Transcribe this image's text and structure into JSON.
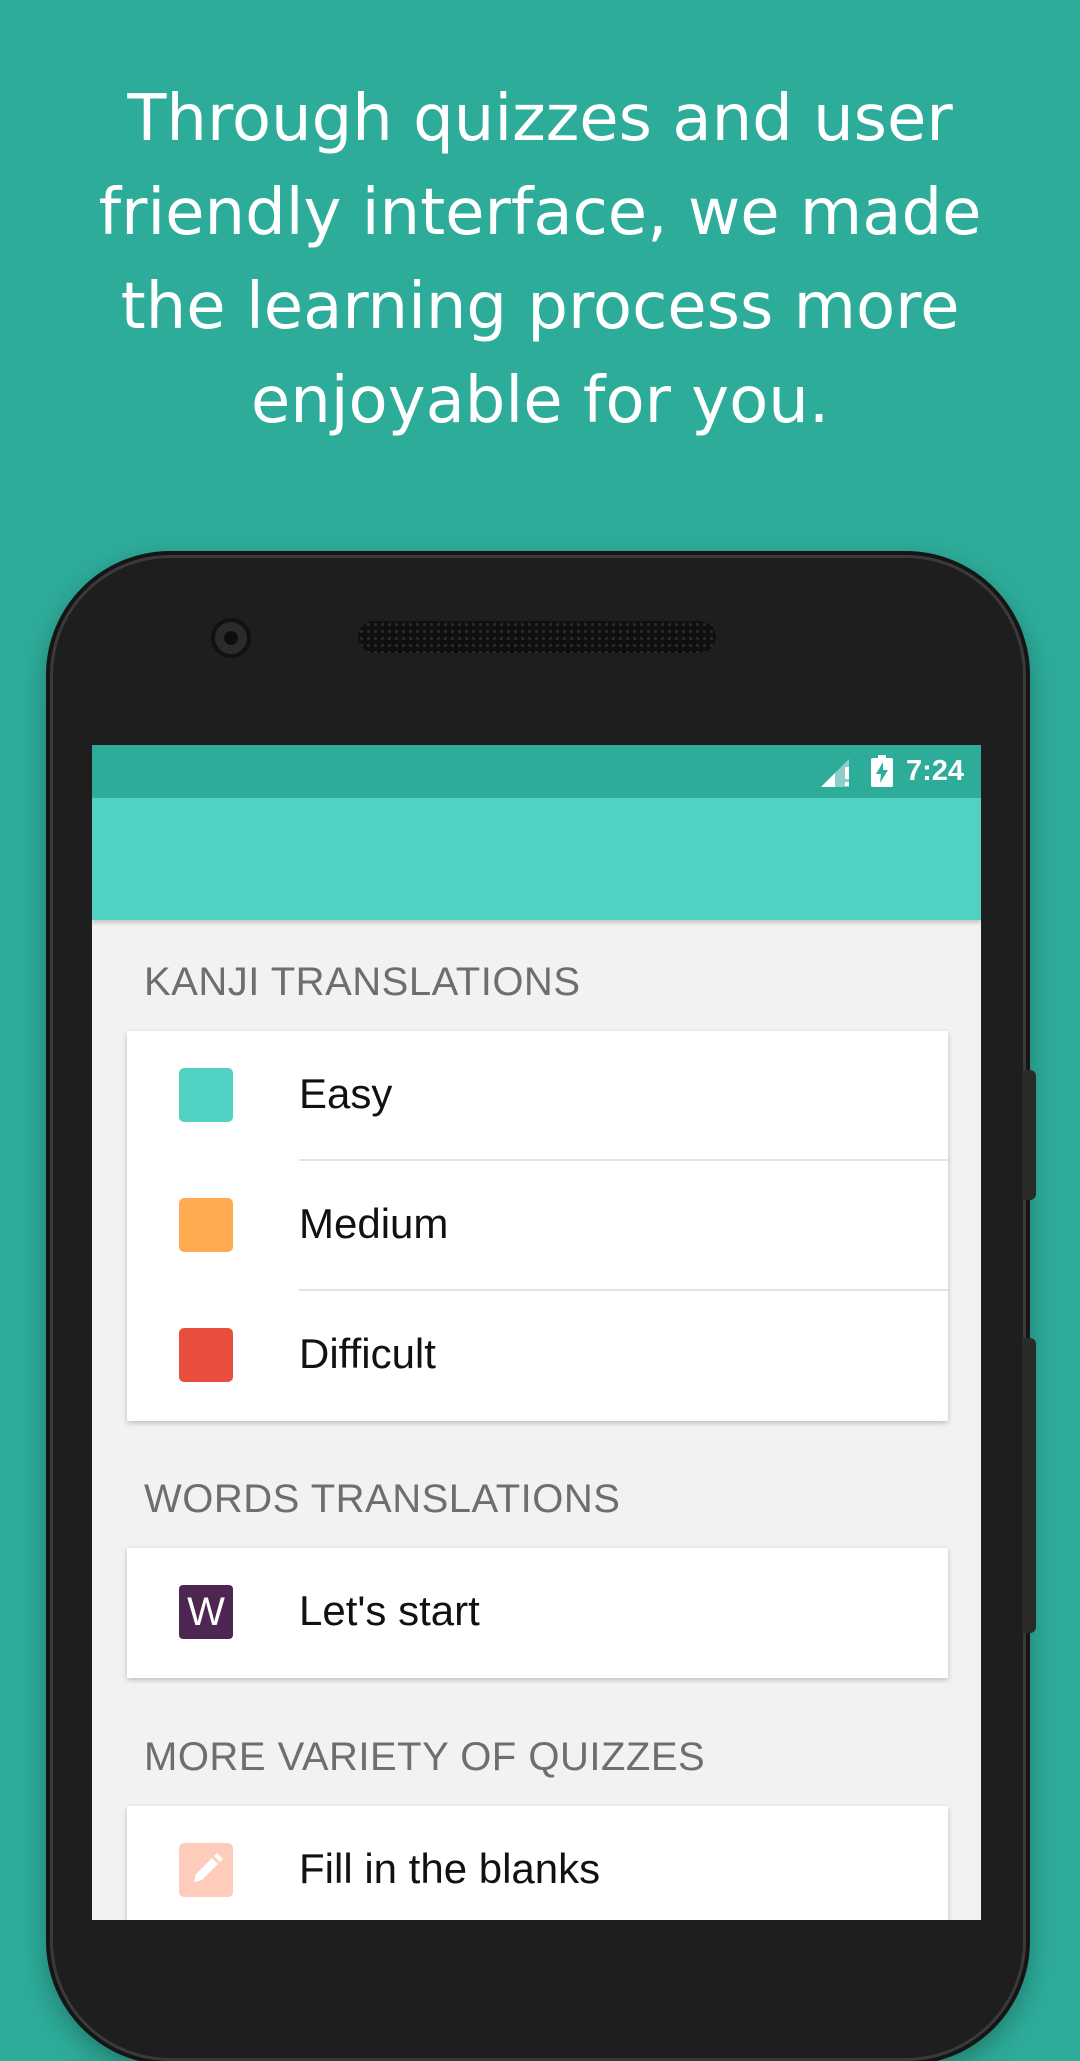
{
  "headline": "Through quizzes and user friendly interface, we made the learning process more enjoyable for you.",
  "status_bar": {
    "time": "7:24",
    "icons": [
      "signal-icon",
      "battery-charging-icon"
    ]
  },
  "sections": [
    {
      "title": "KANJI TRANSLATIONS",
      "items": [
        {
          "label": "Easy",
          "color": "#51d1c1"
        },
        {
          "label": "Medium",
          "color": "#ffab52"
        },
        {
          "label": "Difficult",
          "color": "#e84d3d"
        }
      ]
    },
    {
      "title": "WORDS TRANSLATIONS",
      "items": [
        {
          "label": "Let's start",
          "icon_text": "W",
          "color": "#4e2652"
        }
      ]
    },
    {
      "title": "MORE VARIETY OF QUIZZES",
      "items": [
        {
          "label": "Fill in the blanks",
          "icon": "pencil-icon",
          "color": "#ffccbc"
        }
      ]
    }
  ],
  "colors": {
    "background": "#2eac9a",
    "status_bar": "#2eac9a",
    "app_bar": "#51d1c1"
  }
}
